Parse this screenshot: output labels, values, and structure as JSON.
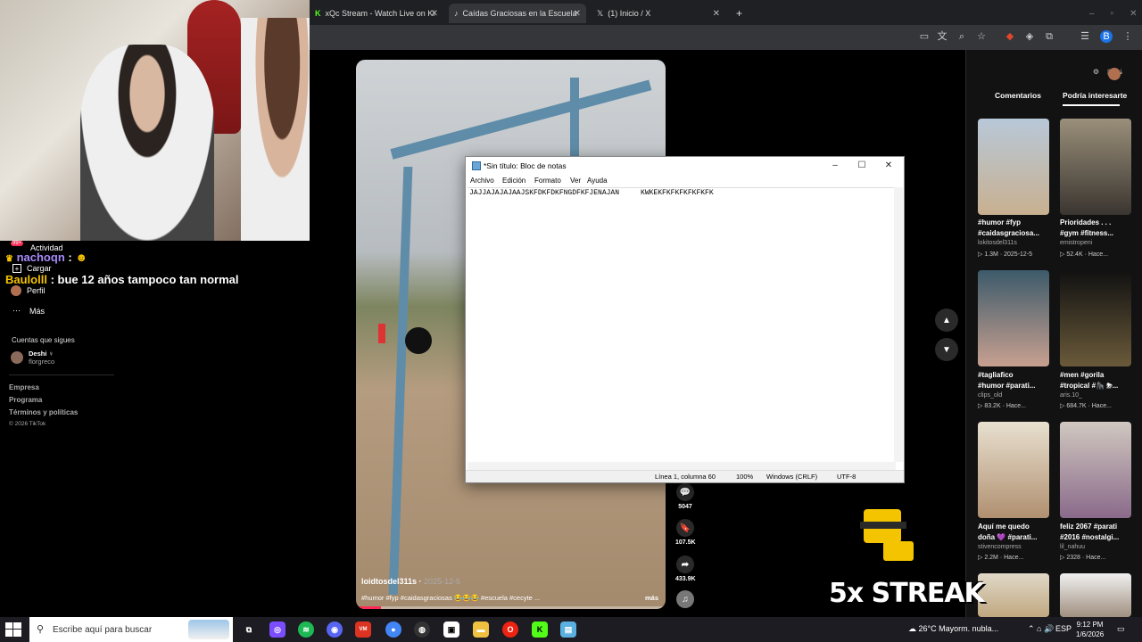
{
  "browser": {
    "tabs": [
      {
        "label": "xQc Stream - Watch Live on Ki",
        "favicon": "kick-icon"
      },
      {
        "label": "Caídas Graciosas en la Escuela",
        "favicon": "tiktok-icon"
      },
      {
        "label": "(1) Inicio / X",
        "favicon": "x-icon"
      }
    ],
    "new_tab": "+"
  },
  "sidebar": {
    "badge": "99+",
    "activity": "Actividad",
    "upload": "Cargar",
    "profile": "Perfil",
    "more": "Más",
    "following_header": "Cuentas que sigues",
    "following": [
      {
        "name": "Deshi ♀",
        "handle": "florgreco"
      }
    ],
    "footer": [
      "Empresa",
      "Programa",
      "Términos y políticas"
    ],
    "copyright": "© 2026 TikTok"
  },
  "chat": [
    {
      "user": "nachoqn",
      "text": ":"
    },
    {
      "user": "Baulolll",
      "text": ": bue 12 años tampoco tan normal"
    }
  ],
  "video": {
    "author": "loidtosdel311s",
    "date": "2025-12-5",
    "caption": "#humor #fyp #caidasgraciosas 😂😂😂 #escuela #cecyte ...",
    "more": "más",
    "comments": "5047",
    "saves": "107.5K",
    "shares": "433.9K"
  },
  "notepad": {
    "title": "*Sin título: Bloc de notas",
    "menu": [
      "Archivo",
      "Edición",
      "Formato",
      "Ver",
      "Ayuda"
    ],
    "content": "JAJJAJAJAJAAJSKFDKFDKFNGDFKFJENAJAN     KWKEKFKFKFKFKFKFK",
    "status": {
      "position": "Línea 1, columna 60",
      "zoom": "100%",
      "eol": "Windows (CRLF)",
      "encoding": "UTF-8"
    }
  },
  "right_panel": {
    "tabs": [
      "Comentarios",
      "Podría interesarte"
    ],
    "active_tab": "Podría interesarte",
    "items": [
      {
        "desc1": "#humor #fyp",
        "desc2": "#caidasgraciosa...",
        "user": "lokitosdel311s",
        "views": "1.3M",
        "date": "2025-12-5"
      },
      {
        "desc1": "Prioridades . . .",
        "desc2": "#gym #fitness...",
        "user": "emistropeni",
        "views": "52.4K",
        "date": "Hace..."
      },
      {
        "desc1": "#tagliafico",
        "desc2": "#humor #parati...",
        "user": "clips_old",
        "views": "83.2K",
        "date": "Hace..."
      },
      {
        "desc1": "#men #gorila",
        "desc2": "#tropical #🦍 ⛈...",
        "user": "aris.10_",
        "views": "684.7K",
        "date": "Hace..."
      },
      {
        "desc1": "Aquí me quedo",
        "desc2": "doña 💜 #parati...",
        "user": "stivencompress",
        "views": "2.2M",
        "date": "Hace..."
      },
      {
        "desc1": "feliz 2067 #parati",
        "desc2": "#2016 #nostalgi...",
        "user": "lil_nahuu",
        "views": "2328",
        "date": "Hace..."
      }
    ]
  },
  "overlay": {
    "streak": "5x STREAK"
  },
  "taskbar": {
    "search_placeholder": "Escribe aquí para buscar",
    "weather": "26°C  Mayorm. nubla...",
    "lang": "ESP",
    "time": "9:12 PM",
    "date": "1/6/2026"
  },
  "colors": {
    "accent": "#fe2c55",
    "tab_active": "#35363a",
    "tab_strip": "#1f2023"
  }
}
